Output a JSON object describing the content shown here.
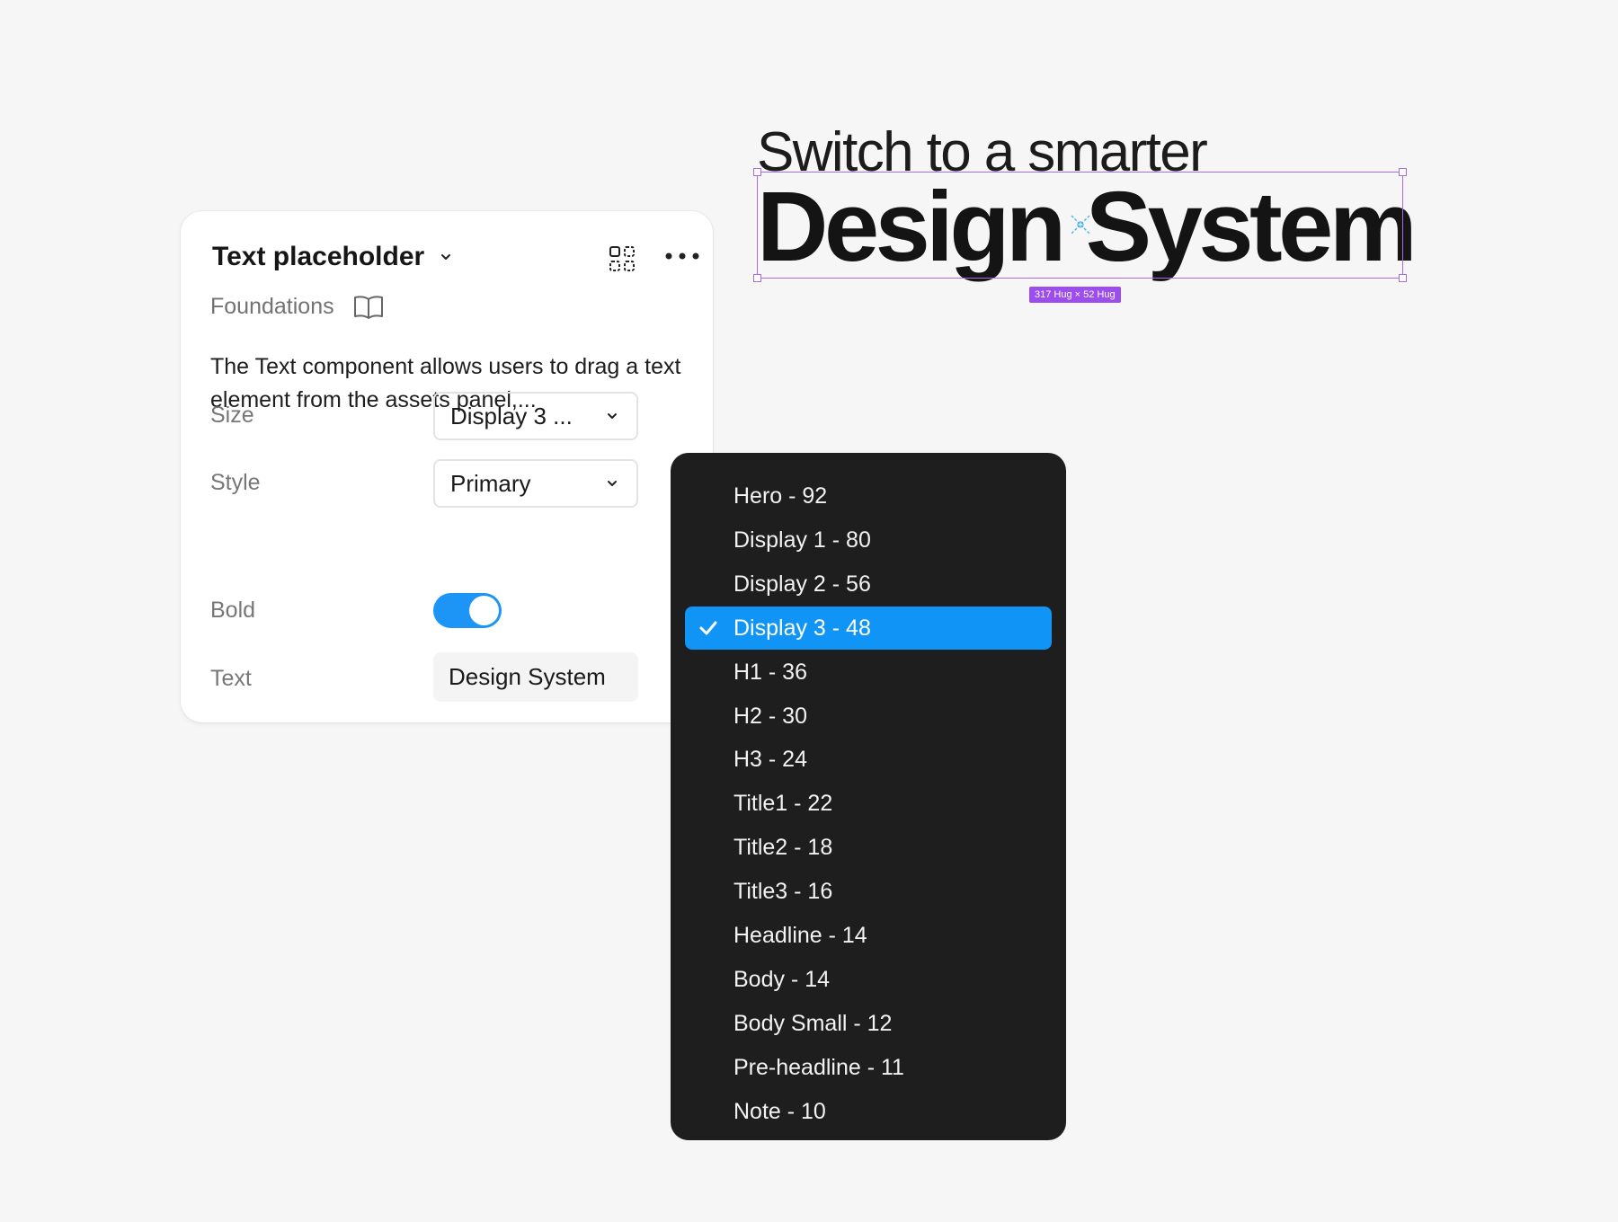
{
  "canvas": {
    "headline_line1": "Switch to a smarter",
    "headline_line2": "Design System",
    "size_badge": "317 Hug × 52 Hug",
    "selection_color": "#a86be8"
  },
  "card": {
    "title": "Text placeholder",
    "title_icon": "chevron-down-icon",
    "actions": [
      "qr-code-icon",
      "more-icon"
    ],
    "subtitle": "Foundations",
    "subtitle_icon": "book-icon",
    "description": "The Text component allows users to drag a text element from the assets panel,...",
    "properties": {
      "size": {
        "label": "Size",
        "value": "Display 3 ..."
      },
      "style": {
        "label": "Style",
        "value": "Primary"
      },
      "bold": {
        "label": "Bold",
        "on": true
      },
      "text": {
        "label": "Text",
        "value": "Design System"
      }
    },
    "toggle_color": "#1d95f7"
  },
  "dropdown": {
    "selected_index": 3,
    "accent": "#1095f6",
    "items": [
      "Hero - 92",
      "Display 1 - 80",
      "Display 2 - 56",
      "Display 3 - 48",
      "H1 - 36",
      "H2 - 30",
      "H3 - 24",
      "Title1 - 22",
      "Title2 - 18",
      "Title3 - 16",
      "Headline - 14",
      "Body - 14",
      "Body Small - 12",
      "Pre-headline - 11",
      "Note - 10"
    ]
  }
}
